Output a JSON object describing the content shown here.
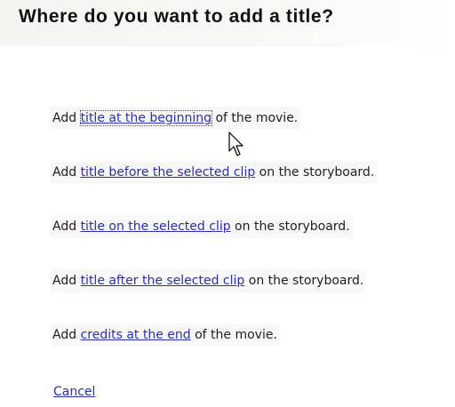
{
  "header": {
    "title": "Where do you want to add a title?"
  },
  "options": [
    {
      "prefix": "Add ",
      "link": "title at the beginning",
      "suffix": " of the movie."
    },
    {
      "prefix": "Add ",
      "link": "title before the selected clip",
      "suffix": " on the storyboard."
    },
    {
      "prefix": "Add ",
      "link": "title on the selected clip",
      "suffix": " on the storyboard."
    },
    {
      "prefix": "Add ",
      "link": "title after the selected clip",
      "suffix": " on the storyboard."
    },
    {
      "prefix": "Add ",
      "link": "credits at the end",
      "suffix": " of the movie."
    }
  ],
  "cancel_label": "Cancel",
  "colors": {
    "link": "#2b2fa8",
    "text": "#1e1e1e",
    "header_bg": "#f4f4f2"
  },
  "cursor_icon": "arrow-cursor-icon"
}
